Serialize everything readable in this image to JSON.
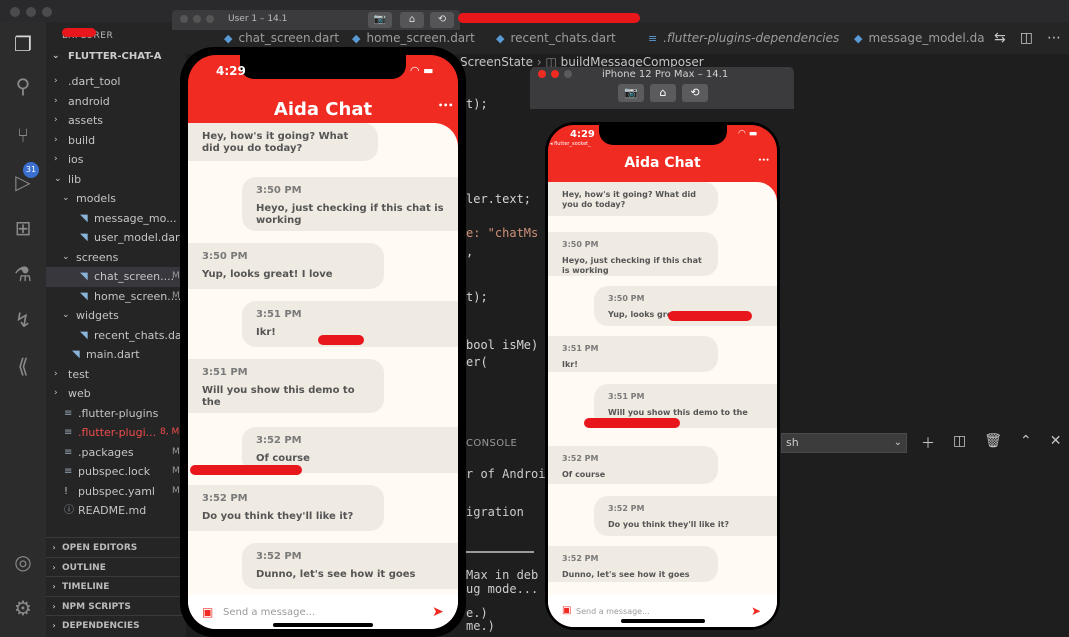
{
  "vscode": {
    "window_title": "User 1 – 14.1",
    "explorer_label": "EXPLORER",
    "project_root": "FLUTTER-CHAT-A",
    "tree": [
      {
        "label": ".dart_tool",
        "kind": "folder",
        "depth": 1,
        "open": false
      },
      {
        "label": "android",
        "kind": "folder",
        "depth": 1,
        "open": false
      },
      {
        "label": "assets",
        "kind": "folder",
        "depth": 1,
        "open": false
      },
      {
        "label": "build",
        "kind": "folder",
        "depth": 1,
        "open": false
      },
      {
        "label": "ios",
        "kind": "folder",
        "depth": 1,
        "open": false
      },
      {
        "label": "lib",
        "kind": "folder",
        "depth": 1,
        "open": true
      },
      {
        "label": "models",
        "kind": "folder",
        "depth": 2,
        "open": true
      },
      {
        "label": "message_mo...",
        "kind": "dart",
        "depth": 3
      },
      {
        "label": "user_model.dart",
        "kind": "dart",
        "depth": 3
      },
      {
        "label": "screens",
        "kind": "folder",
        "depth": 2,
        "open": true
      },
      {
        "label": "chat_screen....",
        "kind": "dart",
        "depth": 3,
        "mark": "M",
        "selected": true
      },
      {
        "label": "home_screen....",
        "kind": "dart",
        "depth": 3,
        "mark": "M"
      },
      {
        "label": "widgets",
        "kind": "folder",
        "depth": 2,
        "open": true
      },
      {
        "label": "recent_chats.dart",
        "kind": "dart",
        "depth": 3
      },
      {
        "label": "main.dart",
        "kind": "dart",
        "depth": 2
      },
      {
        "label": "test",
        "kind": "folder",
        "depth": 1,
        "open": false
      },
      {
        "label": "web",
        "kind": "folder",
        "depth": 1,
        "open": false
      },
      {
        "label": ".flutter-plugins",
        "kind": "file",
        "depth": 1
      },
      {
        "label": ".flutter-plugi...",
        "kind": "file",
        "depth": 1,
        "mark": "8, M",
        "error": true
      },
      {
        "label": ".packages",
        "kind": "file",
        "depth": 1,
        "mark": "M"
      },
      {
        "label": "pubspec.lock",
        "kind": "file",
        "depth": 1,
        "mark": "M"
      },
      {
        "label": "pubspec.yaml",
        "kind": "yaml",
        "depth": 1,
        "mark": "M"
      },
      {
        "label": "README.md",
        "kind": "md",
        "depth": 1
      }
    ],
    "panels": [
      "OPEN EDITORS",
      "OUTLINE",
      "TIMELINE",
      "NPM SCRIPTS",
      "DEPENDENCIES"
    ],
    "tabs": [
      {
        "label": "chat_screen.dart"
      },
      {
        "label": "home_screen.dart"
      },
      {
        "label": "recent_chats.dart"
      },
      {
        "label": ".flutter-plugins-dependencies"
      },
      {
        "label": "message_model.da"
      }
    ],
    "breadcrumb": [
      "ScreenState",
      "buildMessageComposer"
    ],
    "code_lines": [
      "t);",
      "ler.text;",
      "e: \"chatMs",
      ",",
      "t);",
      "bool isMe)",
      "er("
    ],
    "terminal_tab": "CONSOLE",
    "shell_select": "sh",
    "terminal_lines": [
      "r of Androi",
      "igration",
      "Max in deb",
      "ug mode...",
      "e.)",
      "me.)"
    ],
    "activity_badge": "31"
  },
  "simulator": {
    "title": "iPhone 12 Pro Max – 14.1"
  },
  "phones": [
    {
      "id": "large",
      "time": "4:29",
      "title": "Aida Chat",
      "placeholder": "Send a message...",
      "messages": [
        {
          "side": "left",
          "time": "",
          "text": "Hey, how's it going? What did you do today?"
        },
        {
          "side": "right",
          "time": "3:50 PM",
          "text": "Heyo, just checking if this chat is working"
        },
        {
          "side": "left",
          "time": "3:50 PM",
          "text": "Yup, looks great! I love"
        },
        {
          "side": "right",
          "time": "3:51 PM",
          "text": "Ikr!"
        },
        {
          "side": "left",
          "time": "3:51 PM",
          "text": "Will you show this demo to the"
        },
        {
          "side": "right",
          "time": "3:52 PM",
          "text": "Of course"
        },
        {
          "side": "left",
          "time": "3:52 PM",
          "text": "Do you think they'll like it?"
        },
        {
          "side": "right",
          "time": "3:52 PM",
          "text": "Dunno, let's see how it goes"
        }
      ]
    },
    {
      "id": "small",
      "time": "4:29",
      "carrier": "◂ flutter_socket_",
      "title": "Aida Chat",
      "placeholder": "Send a message...",
      "messages": [
        {
          "side": "left",
          "time": "",
          "text": "Hey, how's it going? What did you do today?"
        },
        {
          "side": "left",
          "time": "3:50 PM",
          "text": "Heyo, just checking if this chat is working"
        },
        {
          "side": "right",
          "time": "3:50 PM",
          "text": "Yup, looks great!"
        },
        {
          "side": "left",
          "time": "3:51 PM",
          "text": "Ikr!"
        },
        {
          "side": "right",
          "time": "3:51 PM",
          "text": "Will you show this demo to the"
        },
        {
          "side": "left",
          "time": "3:52 PM",
          "text": "Of course"
        },
        {
          "side": "right",
          "time": "3:52 PM",
          "text": "Do you think they'll like it?"
        },
        {
          "side": "left",
          "time": "3:52 PM",
          "text": "Dunno, let's see how it goes"
        }
      ]
    }
  ],
  "colors": {
    "accent": "#ef2b22",
    "chat_bg": "#fffaf4",
    "bubble": "#efeae2",
    "redaction": "#e8171c"
  }
}
